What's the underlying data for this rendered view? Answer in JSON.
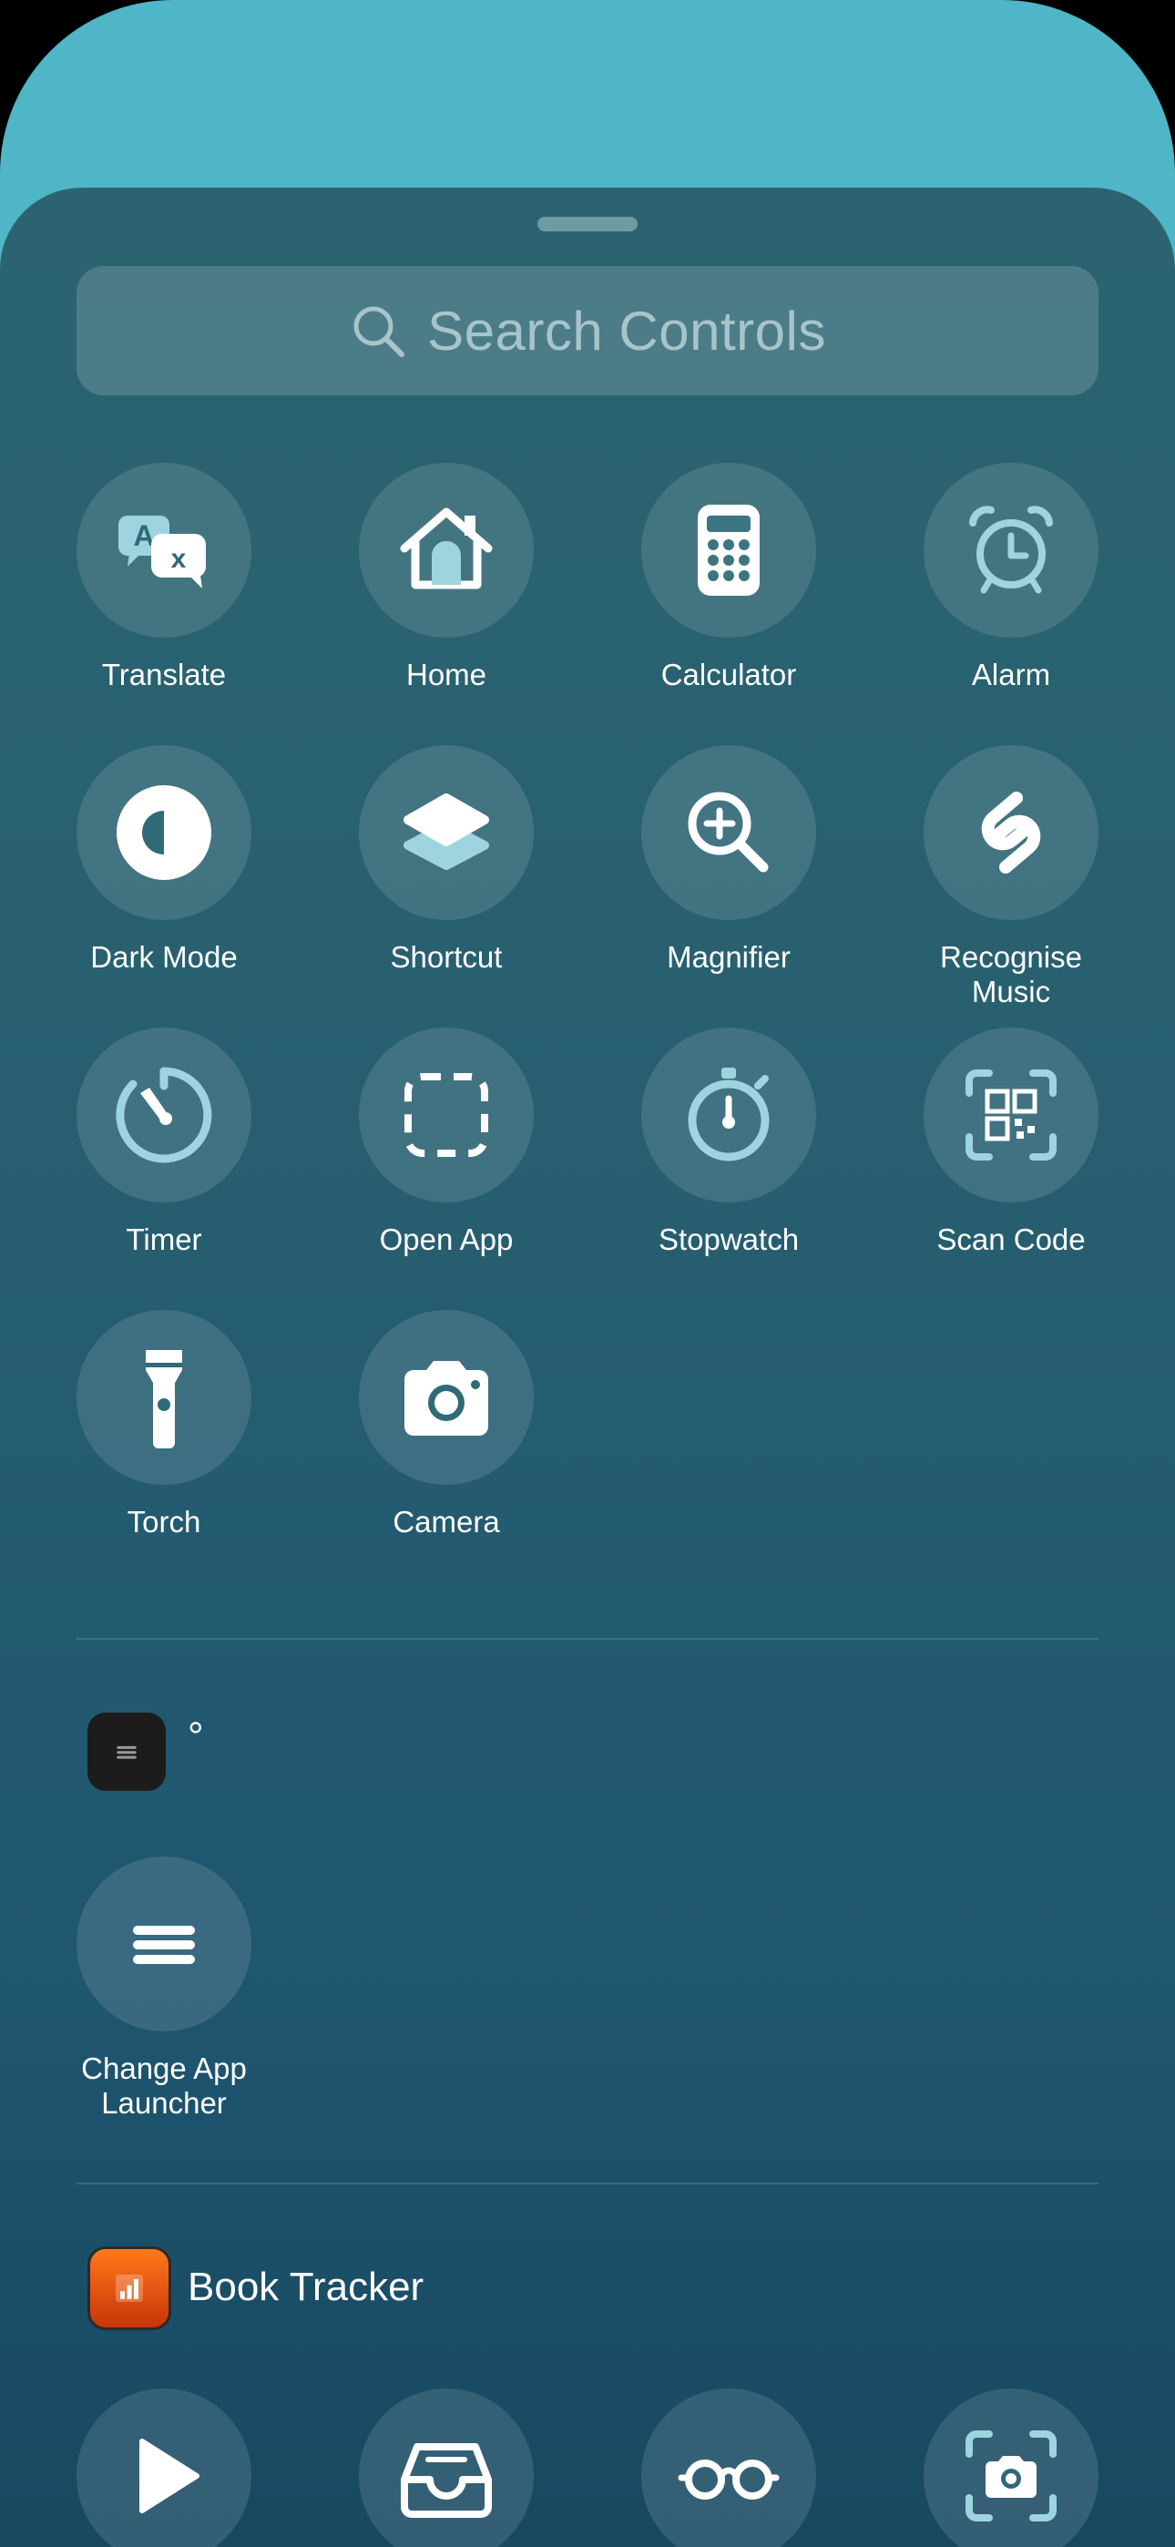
{
  "search": {
    "placeholder": "Search Controls"
  },
  "controls": [
    {
      "label": "Translate",
      "icon": "translate-icon"
    },
    {
      "label": "Home",
      "icon": "home-icon"
    },
    {
      "label": "Calculator",
      "icon": "calculator-icon"
    },
    {
      "label": "Alarm",
      "icon": "alarm-icon"
    },
    {
      "label": "Dark Mode",
      "icon": "dark-mode-icon"
    },
    {
      "label": "Shortcut",
      "icon": "shortcut-icon"
    },
    {
      "label": "Magnifier",
      "icon": "magnifier-icon"
    },
    {
      "label": "Recognise\nMusic",
      "icon": "shazam-icon"
    },
    {
      "label": "Timer",
      "icon": "timer-icon"
    },
    {
      "label": "Open App",
      "icon": "open-app-icon"
    },
    {
      "label": "Stopwatch",
      "icon": "stopwatch-icon"
    },
    {
      "label": "Scan Code",
      "icon": "qr-code-icon"
    },
    {
      "label": "Torch",
      "icon": "flashlight-icon"
    },
    {
      "label": "Camera",
      "icon": "camera-icon"
    }
  ],
  "sections": [
    {
      "app_name": "°",
      "controls": [
        {
          "label": "Change App\nLauncher",
          "icon": "menu-lines-icon"
        }
      ]
    },
    {
      "app_name": "Book Tracker",
      "controls": [
        {
          "icon": "play-icon"
        },
        {
          "icon": "inbox-tray-icon"
        },
        {
          "icon": "reading-glasses-icon"
        },
        {
          "icon": "camera-scan-icon"
        }
      ]
    }
  ],
  "colors": {
    "sheet_top": "#2b6470",
    "sheet_bottom": "#174860",
    "back_card": "#4fb6c8",
    "accent_light": "#9ed4e0"
  }
}
